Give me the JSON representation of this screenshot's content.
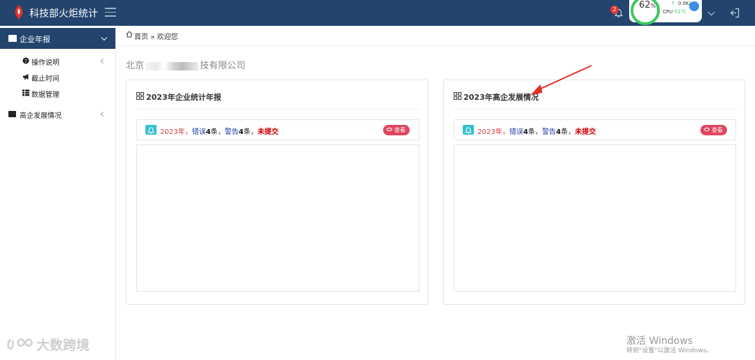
{
  "header": {
    "app_title": "科技部火炬统计",
    "notification_count": "2",
    "perf_percent": "62",
    "perf_percent_unit": "%",
    "perf_net": "0.0K/s",
    "perf_cpu_label": "CPU",
    "perf_cpu_temp": "51°C",
    "colors": {
      "bar": "#22446d",
      "badge": "#e53935",
      "ring": "#3cc760"
    }
  },
  "sidebar": {
    "active_item": {
      "label": "企业年报",
      "icon": "folder-icon"
    },
    "sub_items": [
      {
        "label": "操作说明",
        "icon": "question-circle-icon"
      },
      {
        "label": "截止时间",
        "icon": "megaphone-icon"
      },
      {
        "label": "数据管理",
        "icon": "list-icon"
      }
    ],
    "items": [
      {
        "label": "高企发展情况",
        "icon": "folder-icon"
      }
    ]
  },
  "breadcrumb": {
    "home": "首页",
    "separator": "»",
    "current": "欢迎您"
  },
  "company": {
    "prefix": "北京",
    "suffix": "技有限公司"
  },
  "cards": [
    {
      "title": "2023年企业统计年报",
      "notice": {
        "year": "2023年",
        "sep1": "，",
        "error_label": "错误",
        "error_count": "4",
        "error_unit": "条",
        "sep2": "，",
        "warn_label": "警告",
        "warn_count": "4",
        "warn_unit": "条",
        "sep3": "，",
        "status": "未提交"
      },
      "view_label": "查看"
    },
    {
      "title": "2023年高企发展情况",
      "notice": {
        "year": "2023年",
        "sep1": "，",
        "error_label": "错误",
        "error_count": "4",
        "error_unit": "条",
        "sep2": "，",
        "warn_label": "警告",
        "warn_count": "4",
        "warn_unit": "条",
        "sep3": "，",
        "status": "未提交"
      },
      "view_label": "查看"
    }
  ],
  "watermark": {
    "text": "大数跨境"
  },
  "activation": {
    "title": "激活 Windows",
    "subtitle": "转到\"设置\"以激活 Windows。"
  }
}
